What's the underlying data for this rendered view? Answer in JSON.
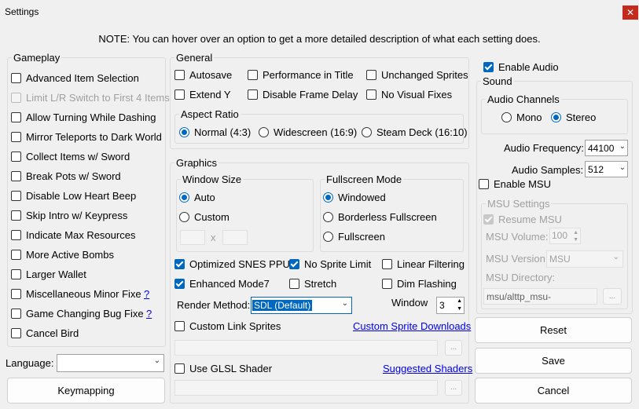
{
  "window": {
    "title": "Settings",
    "close_icon": "close-icon"
  },
  "note": "NOTE: You can hover over an option to get a more detailed description of what each setting does.",
  "gameplay": {
    "legend": "Gameplay",
    "items": [
      {
        "label": "Advanced Item Selection",
        "checked": false,
        "enabled": true
      },
      {
        "label": "Limit L/R Switch to First 4 Items",
        "checked": false,
        "enabled": false
      },
      {
        "label": "Allow Turning While Dashing",
        "checked": false,
        "enabled": true
      },
      {
        "label": "Mirror Teleports to Dark World",
        "checked": false,
        "enabled": true
      },
      {
        "label": "Collect Items w/ Sword",
        "checked": false,
        "enabled": true
      },
      {
        "label": "Break Pots w/ Sword",
        "checked": false,
        "enabled": true
      },
      {
        "label": "Disable Low Heart Beep",
        "checked": false,
        "enabled": true
      },
      {
        "label": "Skip Intro w/ Keypress",
        "checked": false,
        "enabled": true
      },
      {
        "label": "Indicate Max Resources",
        "checked": false,
        "enabled": true
      },
      {
        "label": "More Active Bombs",
        "checked": false,
        "enabled": true
      },
      {
        "label": "Larger Wallet",
        "checked": false,
        "enabled": true
      },
      {
        "label": "Miscellaneous Minor Fixe",
        "checked": false,
        "enabled": true,
        "help": "?"
      },
      {
        "label": "Game Changing Bug Fixe",
        "checked": false,
        "enabled": true,
        "help": "?"
      },
      {
        "label": "Cancel Bird",
        "checked": false,
        "enabled": true
      }
    ]
  },
  "language": {
    "label": "Language:",
    "value": ""
  },
  "keymapping_label": "Keymapping",
  "general": {
    "legend": "General",
    "autosave": "Autosave",
    "perf_title": "Performance in Title",
    "unchanged_sprites": "Unchanged Sprites",
    "extend_y": "Extend Y",
    "disable_frame_delay": "Disable Frame Delay",
    "no_visual_fixes": "No Visual Fixes",
    "aspect": {
      "legend": "Aspect Ratio",
      "normal": "Normal (4:3)",
      "wide": "Widescreen (16:9)",
      "deck": "Steam Deck (16:10)",
      "selected": "normal"
    }
  },
  "graphics": {
    "legend": "Graphics",
    "window_size": {
      "legend": "Window Size",
      "auto": "Auto",
      "custom": "Custom",
      "x": "x",
      "selected": "auto"
    },
    "fullscreen": {
      "legend": "Fullscreen Mode",
      "windowed": "Windowed",
      "borderless": "Borderless Fullscreen",
      "full": "Fullscreen",
      "selected": "windowed"
    },
    "optimized_ppu": "Optimized SNES PPU",
    "no_sprite_limit": "No Sprite Limit",
    "linear_filtering": "Linear Filtering",
    "enhanced_mode7": "Enhanced Mode7",
    "stretch": "Stretch",
    "dim_flashing": "Dim Flashing",
    "render_method_label": "Render Method:",
    "render_method_value": "SDL (Default)",
    "window_label": "Window",
    "window_value": "3",
    "custom_link_sprites": "Custom Link Sprites",
    "custom_sprite_downloads": "Custom Sprite Downloads",
    "use_glsl": "Use GLSL Shader",
    "suggested_shaders": "Suggested Shaders",
    "browse": "..."
  },
  "audio": {
    "enable_audio": "Enable Audio",
    "sound_legend": "Sound",
    "channels": {
      "legend": "Audio Channels",
      "mono": "Mono",
      "stereo": "Stereo",
      "selected": "stereo"
    },
    "frequency_label": "Audio Frequency:",
    "frequency_value": "44100",
    "samples_label": "Audio Samples:",
    "samples_value": "512",
    "enable_msu": "Enable MSU",
    "msu": {
      "legend": "MSU Settings",
      "resume": "Resume MSU",
      "volume_label": "MSU Volume:",
      "volume_value": "100",
      "version_label": "MSU Version",
      "version_value": "MSU",
      "directory_label": "MSU Directory:",
      "directory_value": "msu/alttp_msu-"
    }
  },
  "buttons": {
    "reset": "Reset",
    "save": "Save",
    "cancel": "Cancel"
  },
  "colors": {
    "accent": "#0067c0",
    "close": "#c42b1c",
    "link": "#0000ee"
  }
}
